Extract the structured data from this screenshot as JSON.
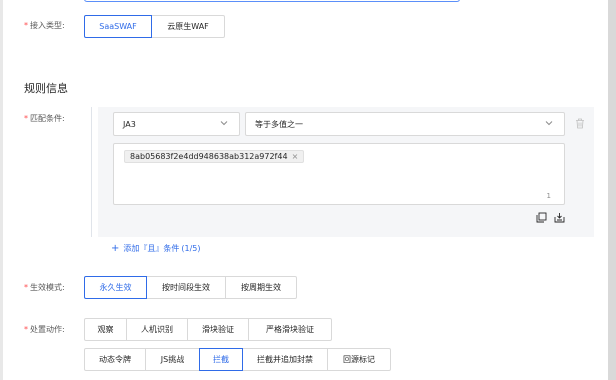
{
  "access": {
    "label": "接入类型:",
    "options": [
      "SaaSWAF",
      "云原生WAF"
    ],
    "selected": "SaaSWAF"
  },
  "rule_section": {
    "title": "规则信息"
  },
  "match": {
    "label": "匹配条件:",
    "field_select": "JA3",
    "operator_select": "等于多值之一",
    "tag_value": "8ab05683f2e4dd948638ab312a972f44",
    "counter": "1",
    "add_label": "添加『且』条件",
    "add_count": "(1/5)"
  },
  "effect": {
    "label": "生效模式:",
    "options": [
      "永久生效",
      "按时间段生效",
      "按周期生效"
    ],
    "selected": "永久生效"
  },
  "action": {
    "label": "处置动作:",
    "row1": [
      "观察",
      "人机识别",
      "滑块验证",
      "严格滑块验证"
    ],
    "row2": [
      "动态令牌",
      "JS挑战",
      "拦截",
      "拦截并追加封禁",
      "回源标记"
    ],
    "selected": "拦截"
  },
  "colors": {
    "accent": "#2f6be8",
    "required": "#ff4d4f",
    "panel_bg": "#f5f6f8"
  },
  "icons": [
    "chevron-down-icon",
    "trash-icon",
    "copy-icon",
    "import-icon",
    "plus-icon",
    "close-icon"
  ]
}
